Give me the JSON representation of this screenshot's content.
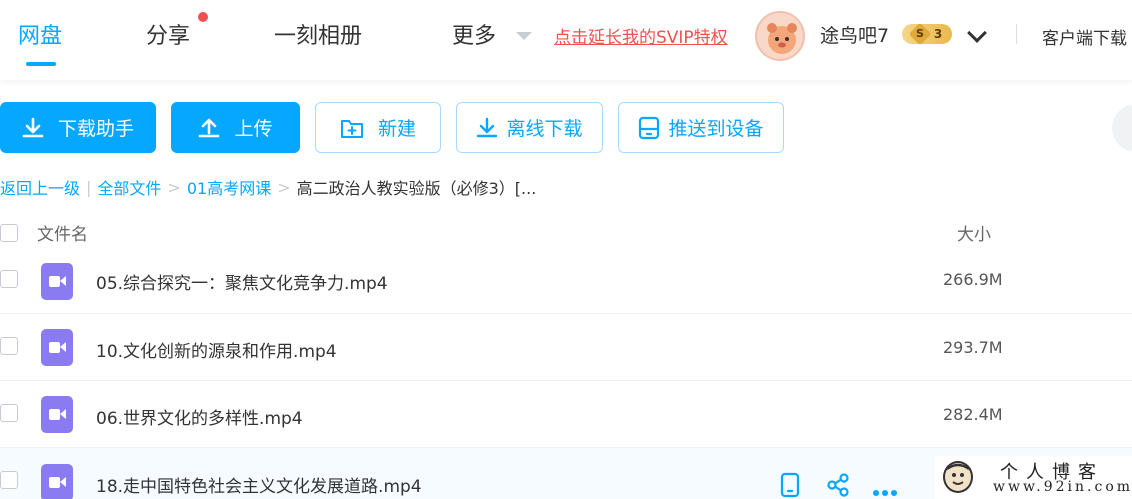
{
  "nav": {
    "items": [
      {
        "label": "网盘",
        "active": true
      },
      {
        "label": "分享",
        "active": false
      },
      {
        "label": "一刻相册",
        "active": false
      },
      {
        "label": "更多",
        "active": false
      }
    ],
    "svip_promo": "点击延长我的SVIP特权",
    "username": "途鸟吧7",
    "level_icon": "S",
    "level": "3",
    "client_download": "客户端下载"
  },
  "toolbar": {
    "download_helper": "下载助手",
    "upload": "上传",
    "new_folder": "新建",
    "offline_download": "离线下载",
    "push_device": "推送到设备"
  },
  "breadcrumb": {
    "back": "返回上一级",
    "separator": "|",
    "path": [
      "全部文件",
      "01高考网课"
    ],
    "arrow": ">",
    "current": "高二政治人教实验版（必修3）[..."
  },
  "table": {
    "columns": {
      "name": "文件名",
      "size": "大小"
    },
    "rows": [
      {
        "name": "05.综合探究一：聚焦文化竞争力.mp4",
        "size": "266.9M",
        "hover": false
      },
      {
        "name": "10.文化创新的源泉和作用.mp4",
        "size": "293.7M",
        "hover": false
      },
      {
        "name": "06.世界文化的多样性.mp4",
        "size": "282.4M",
        "hover": false
      },
      {
        "name": "18.走中国特色社会主义文化发展道路.mp4",
        "size": "",
        "hover": true
      }
    ]
  },
  "row_actions": [
    "phone-icon",
    "share-icon",
    "more-icon"
  ],
  "watermark": {
    "title": "个人博客",
    "url": "www.92in.com"
  },
  "colors": {
    "accent": "#06a7ff",
    "promo": "#f25050",
    "video_icon": "#8b7bf0"
  }
}
